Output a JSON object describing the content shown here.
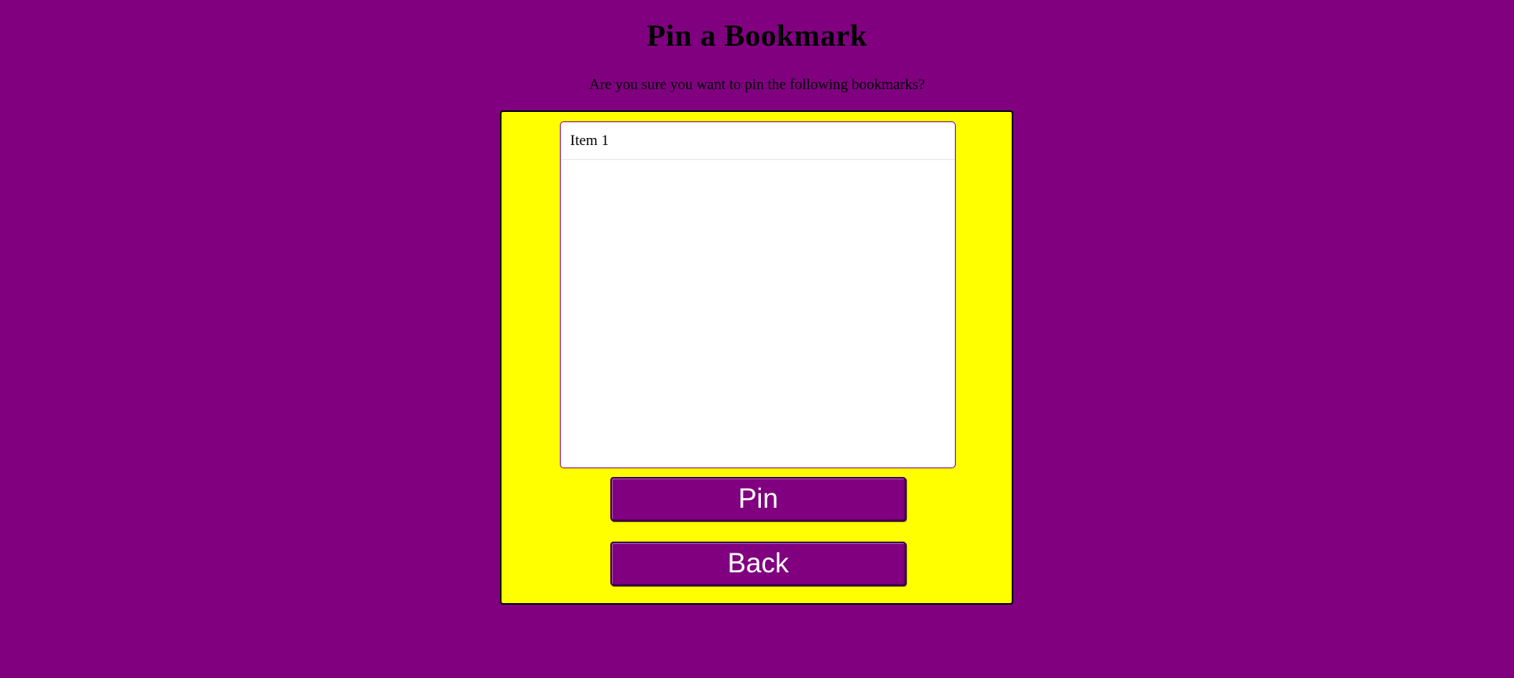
{
  "page": {
    "title": "Pin a Bookmark",
    "prompt": "Are you sure you want to pin the following bookmarks?"
  },
  "bookmarks": {
    "items": [
      {
        "label": "Item 1"
      }
    ]
  },
  "actions": {
    "pin_label": "Pin",
    "back_label": "Back"
  },
  "colors": {
    "background": "#800080",
    "panel": "#ffff00",
    "button": "#800080",
    "button_text": "#ffffff"
  }
}
